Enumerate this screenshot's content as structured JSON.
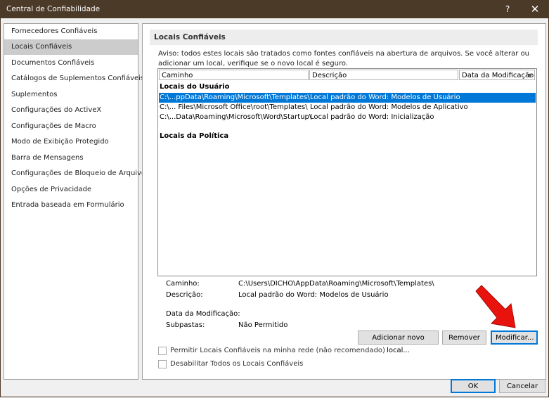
{
  "window": {
    "title": "Central de Confiabilidade",
    "help_label": "?",
    "close_label": "✕"
  },
  "sidebar": {
    "items": [
      {
        "label": "Fornecedores Confiáveis",
        "selected": false
      },
      {
        "label": "Locais Confiáveis",
        "selected": true
      },
      {
        "label": "Documentos Confiáveis",
        "selected": false
      },
      {
        "label": "Catálogos de Suplementos Confiáveis",
        "selected": false
      },
      {
        "label": "Suplementos",
        "selected": false
      },
      {
        "label": "Configurações do ActiveX",
        "selected": false
      },
      {
        "label": "Configurações de Macro",
        "selected": false
      },
      {
        "label": "Modo de Exibição Protegido",
        "selected": false
      },
      {
        "label": "Barra de Mensagens",
        "selected": false
      },
      {
        "label": "Configurações de Bloqueio de Arquivo",
        "selected": false
      },
      {
        "label": "Opções de Privacidade",
        "selected": false
      },
      {
        "label": "Entrada baseada em Formulário",
        "selected": false
      }
    ]
  },
  "main": {
    "section_title": "Locais Confiáveis",
    "warning": "Aviso: todos estes locais são tratados como fontes confiáveis na abertura de arquivos.  Se você alterar ou adicionar um local, verifique se o novo local é seguro.",
    "table": {
      "columns": [
        "Caminho",
        "Descrição",
        "Data da Modificação"
      ],
      "user_group_label": "Locais do Usuário",
      "rows": [
        {
          "path": "C:\\...ppData\\Roaming\\Microsoft\\Templates\\",
          "description": "Local padrão do Word: Modelos de Usuário",
          "date": "",
          "selected": true
        },
        {
          "path": "C:\\... Files\\Microsoft Office\\root\\Templates\\",
          "description": "Local padrão do Word: Modelos de Aplicativo",
          "date": "",
          "selected": false
        },
        {
          "path": "C:\\...Data\\Roaming\\Microsoft\\Word\\Startup\\",
          "description": "Local padrão do Word: Inicialização",
          "date": "",
          "selected": false
        }
      ],
      "policy_group_label": "Locais da Política"
    },
    "details": {
      "path_label": "Caminho:",
      "path_value": "C:\\Users\\DICHO\\AppData\\Roaming\\Microsoft\\Templates\\",
      "description_label": "Descrição:",
      "description_value": "Local padrão do Word: Modelos de Usuário",
      "date_label": "Data da Modificação:",
      "date_value": "",
      "subfolders_label": "Subpastas:",
      "subfolders_value": "Não Permitido"
    },
    "buttons": {
      "add": "Adicionar novo local...",
      "remove": "Remover",
      "modify": "Modificar..."
    },
    "checkboxes": [
      {
        "label": "Permitir Locais Confiáveis na minha rede (não recomendado)",
        "checked": false
      },
      {
        "label": "Desabilitar Todos os Locais Confiáveis",
        "checked": false
      }
    ]
  },
  "footer": {
    "ok": "OK",
    "cancel": "Cancelar"
  },
  "colors": {
    "title_bar": "#4c3a28",
    "selection": "#0078d7",
    "annotation_arrow": "#e8130c"
  },
  "icons": {
    "sort": "chevron-down-icon",
    "annotation": "red-arrow-icon"
  }
}
